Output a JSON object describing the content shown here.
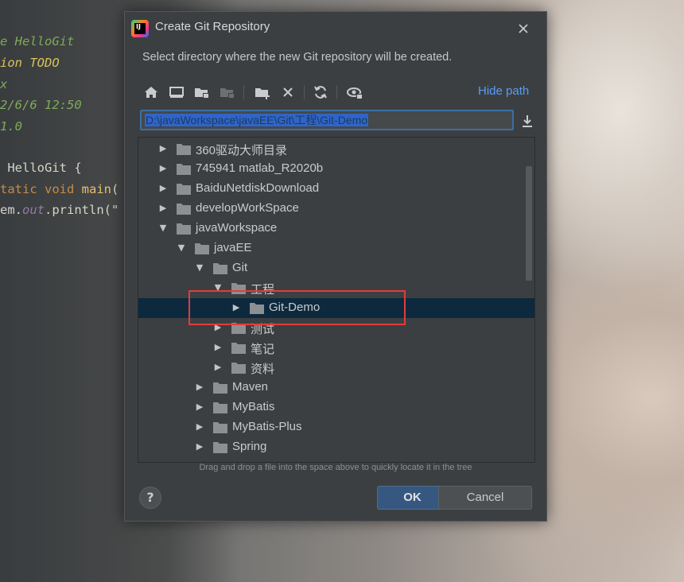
{
  "background": {
    "code_lines": [
      {
        "parts": [
          {
            "t": "e ",
            "c": "c-green"
          },
          {
            "t": "HelloGit",
            "c": "c-green"
          }
        ]
      },
      {
        "parts": [
          {
            "t": "ion",
            "c": "c-yellow"
          },
          {
            "t": " TODO",
            "c": "c-yellow"
          }
        ]
      },
      {
        "parts": [
          {
            "t": "x",
            "c": "c-green"
          }
        ]
      },
      {
        "parts": [
          {
            "t": "2/6/6 12:50",
            "c": "c-green"
          }
        ]
      },
      {
        "parts": [
          {
            "t": "1.0",
            "c": "c-green"
          }
        ]
      },
      {
        "parts": [
          {
            "t": "",
            "c": "c-plain"
          }
        ]
      },
      {
        "parts": [
          {
            "t": " HelloGit {",
            "c": "c-plain"
          }
        ]
      },
      {
        "parts": [
          {
            "t": "tatic void ",
            "c": "c-orange"
          },
          {
            "t": "main",
            "c": "c-fn"
          },
          {
            "t": "(",
            "c": "c-plain"
          }
        ]
      },
      {
        "parts": [
          {
            "t": "em.",
            "c": "c-plain"
          },
          {
            "t": "out",
            "c": "c-field"
          },
          {
            "t": ".println(\"",
            "c": "c-plain"
          }
        ]
      }
    ]
  },
  "dialog": {
    "title": "Create Git Repository",
    "subtitle": "Select directory where the new Git repository will be created.",
    "hide_path_label": "Hide path",
    "path_value": "D:\\javaWorkspace\\javaEE\\Git\\工程\\Git-Demo",
    "hint": "Drag and drop a file into the space above to quickly locate it in the tree",
    "ok_label": "OK",
    "cancel_label": "Cancel",
    "help_label": "?",
    "toolbar_icons": [
      "home-icon",
      "desktop-icon",
      "project-folder-icon",
      "module-folder-icon",
      "new-folder-icon",
      "delete-icon",
      "refresh-icon",
      "show-hidden-icon"
    ]
  },
  "tree": {
    "items": [
      {
        "label": "360驱动大师目录",
        "level": 0,
        "expanded": false
      },
      {
        "label": "745941 matlab_R2020b",
        "level": 0,
        "expanded": false
      },
      {
        "label": "BaiduNetdiskDownload",
        "level": 0,
        "expanded": false
      },
      {
        "label": "developWorkSpace",
        "level": 0,
        "expanded": false
      },
      {
        "label": "javaWorkspace",
        "level": 0,
        "expanded": true
      },
      {
        "label": "javaEE",
        "level": 1,
        "expanded": true
      },
      {
        "label": "Git",
        "level": 2,
        "expanded": true
      },
      {
        "label": "工程",
        "level": 3,
        "expanded": true
      },
      {
        "label": "Git-Demo",
        "level": 4,
        "expanded": false,
        "selected": true
      },
      {
        "label": "测试",
        "level": 3,
        "expanded": false
      },
      {
        "label": "笔记",
        "level": 3,
        "expanded": false
      },
      {
        "label": "资料",
        "level": 3,
        "expanded": false
      },
      {
        "label": "Maven",
        "level": 2,
        "expanded": false
      },
      {
        "label": "MyBatis",
        "level": 2,
        "expanded": false
      },
      {
        "label": "MyBatis-Plus",
        "level": 2,
        "expanded": false
      },
      {
        "label": "Spring",
        "level": 2,
        "expanded": false
      }
    ]
  },
  "colors": {
    "dialog_bg": "#3c3f41",
    "selection": "#0d293e",
    "link": "#589df6",
    "highlight_box": "#e23c3c",
    "ok_button": "#365880"
  }
}
